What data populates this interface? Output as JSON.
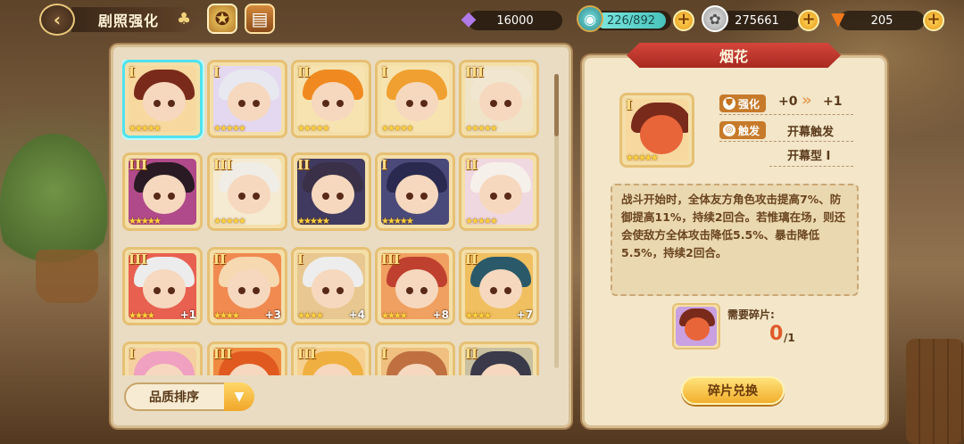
{
  "header": {
    "back_icon": "back-arrow-icon",
    "title": "剧照强化",
    "clover_icon": "clover-icon",
    "icon1": "compass-medal-icon",
    "icon2": "book-icon",
    "gems": "16000",
    "stamina": "226/892",
    "coins": "275661",
    "carrots": "205"
  },
  "cards": [
    {
      "rank": "I",
      "stars": "★★★★★",
      "bonus": "",
      "hair": "#7a2a1a",
      "bg": "#f7d9a0",
      "selected": true
    },
    {
      "rank": "I",
      "stars": "★★★★★",
      "bonus": "",
      "hair": "#e8e8f0",
      "bg": "#e4d8f0"
    },
    {
      "rank": "II",
      "stars": "★★★★★",
      "bonus": "",
      "hair": "#f08a20",
      "bg": "#f7e3b0"
    },
    {
      "rank": "I",
      "stars": "★★★★★",
      "bonus": "",
      "hair": "#f0a030",
      "bg": "#f7e3b0"
    },
    {
      "rank": "III",
      "stars": "★★★★★",
      "bonus": "",
      "hair": "#f1e6d0",
      "bg": "#f0e4c8"
    },
    {
      "rank": "III",
      "stars": "★★★★★",
      "bonus": "",
      "hair": "#2a1a24",
      "bg": "#b04a8a"
    },
    {
      "rank": "III",
      "stars": "★★★★★",
      "bonus": "",
      "hair": "#f0ede6",
      "bg": "#f5ead2"
    },
    {
      "rank": "II",
      "stars": "★★★★★",
      "bonus": "",
      "hair": "#3a3148",
      "bg": "#403a60"
    },
    {
      "rank": "I",
      "stars": "★★★★★",
      "bonus": "",
      "hair": "#2a2a50",
      "bg": "#4a4a7a"
    },
    {
      "rank": "II",
      "stars": "★★★★★",
      "bonus": "",
      "hair": "#f6f0ea",
      "bg": "#f0d8e0"
    },
    {
      "rank": "III",
      "stars": "★★★★",
      "bonus": "+1",
      "hair": "#ececec",
      "bg": "#e86050"
    },
    {
      "rank": "II",
      "stars": "★★★★",
      "bonus": "+3",
      "hair": "#f6d9b0",
      "bg": "#f08a50"
    },
    {
      "rank": "I",
      "stars": "★★★★",
      "bonus": "+4",
      "hair": "#ededed",
      "bg": "#e8c890"
    },
    {
      "rank": "III",
      "stars": "★★★★",
      "bonus": "+8",
      "hair": "#c04030",
      "bg": "#f0a060"
    },
    {
      "rank": "II",
      "stars": "★★★★",
      "bonus": "+7",
      "hair": "#2a5a6a",
      "bg": "#f0c060"
    },
    {
      "rank": "I",
      "stars": "",
      "bonus": "",
      "hair": "#f0a0c0",
      "bg": "#f5d0a0"
    },
    {
      "rank": "III",
      "stars": "",
      "bonus": "",
      "hair": "#e05a20",
      "bg": "#f08a40"
    },
    {
      "rank": "III",
      "stars": "",
      "bonus": "",
      "hair": "#f0b040",
      "bg": "#f6d090"
    },
    {
      "rank": "I",
      "stars": "",
      "bonus": "",
      "hair": "#c07040",
      "bg": "#f0c080"
    },
    {
      "rank": "II",
      "stars": "",
      "bonus": "",
      "hair": "#3a3a4a",
      "bg": "#c8c0a0"
    }
  ],
  "sort": {
    "label": "品质排序",
    "arrow_icon": "dropdown-arrow-icon"
  },
  "detail": {
    "name": "烟花",
    "rank": "I",
    "stars": "★★★★★",
    "enhance_label": "强化",
    "enhance_from": "+0",
    "enhance_arrows": "»",
    "enhance_to": "+1",
    "trigger_label": "触发",
    "trigger_value": "开幕触发",
    "type_value": "开幕型 I",
    "description": "战斗开始时，全体友方角色攻击提高7%、防御提高11%，持续2回合。若惟璃在场，则还会使敌方全体攻击降低5.5%、暴击降低5.5%，持续2回合。",
    "shard_label": "需要碎片:",
    "shard_have": "0",
    "shard_need": "/1",
    "exchange_button": "碎片兑换"
  }
}
